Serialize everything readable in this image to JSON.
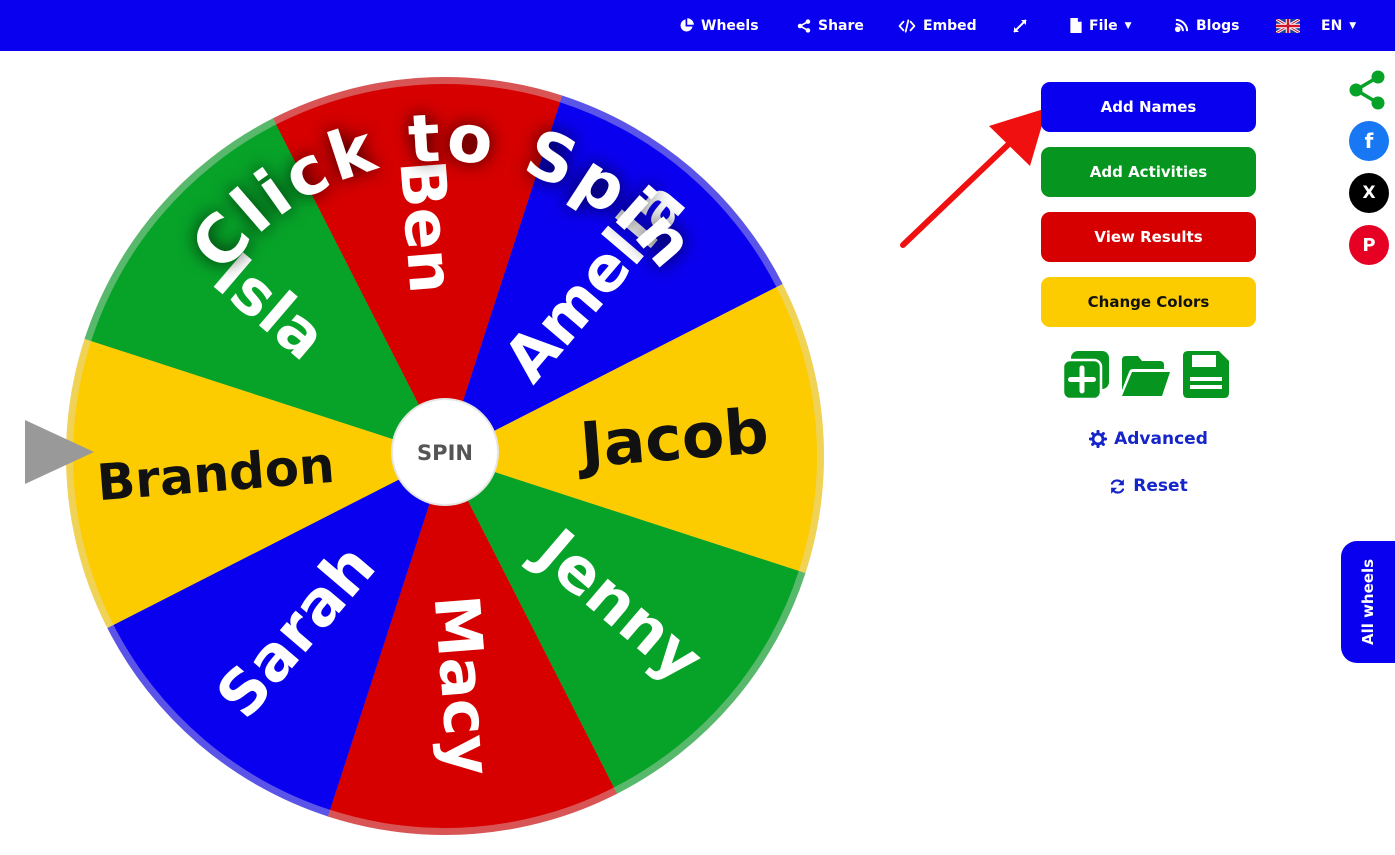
{
  "nav": {
    "wheels": "Wheels",
    "share": "Share",
    "embed": "Embed",
    "file": "File",
    "blogs": "Blogs",
    "language": "EN"
  },
  "wheel": {
    "overlay_text": "Click to Spin",
    "spin_label": "SPIN",
    "colors": {
      "red": "#d60000",
      "blue": "#0a00f0",
      "yellow": "#fccc00",
      "green": "#06a328"
    },
    "segments": [
      "Amelia",
      "Jacob",
      "Jenny",
      "Macy",
      "Sarah",
      "Brandon",
      "Isla",
      "Ben"
    ]
  },
  "panel": {
    "add_names": "Add Names",
    "add_activities": "Add Activities",
    "view_results": "View Results",
    "change_colors": "Change Colors",
    "advanced": "Advanced",
    "reset": "Reset"
  },
  "sidebar": {
    "facebook": "f",
    "x": "X",
    "pinterest": "P",
    "all_wheels": "All wheels"
  }
}
